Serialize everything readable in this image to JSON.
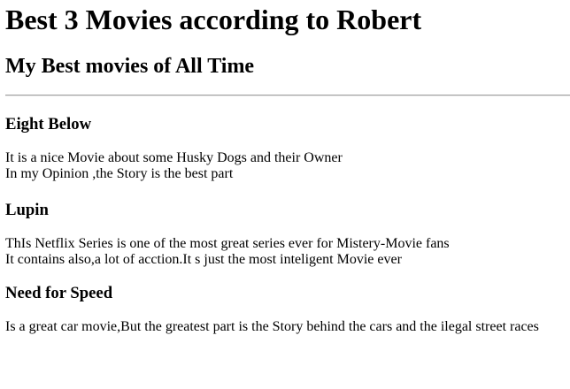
{
  "page": {
    "title": "Best 3 Movies according to Robert",
    "subtitle": "My Best movies of All Time"
  },
  "movies": [
    {
      "title": "Eight Below",
      "lines": [
        "It is a nice Movie about some Husky Dogs and their Owner",
        "In my Opinion ,the Story is the best part"
      ]
    },
    {
      "title": "Lupin",
      "lines": [
        "ThIs Netflix Series is one of the most great series ever for Mistery-Movie fans",
        "It contains also,a lot of acction.It s just the most inteligent Movie ever"
      ]
    },
    {
      "title": "Need for Speed",
      "lines": [
        "Is a great car movie,But the greatest part is the Story behind the cars and the ilegal street races"
      ]
    }
  ]
}
